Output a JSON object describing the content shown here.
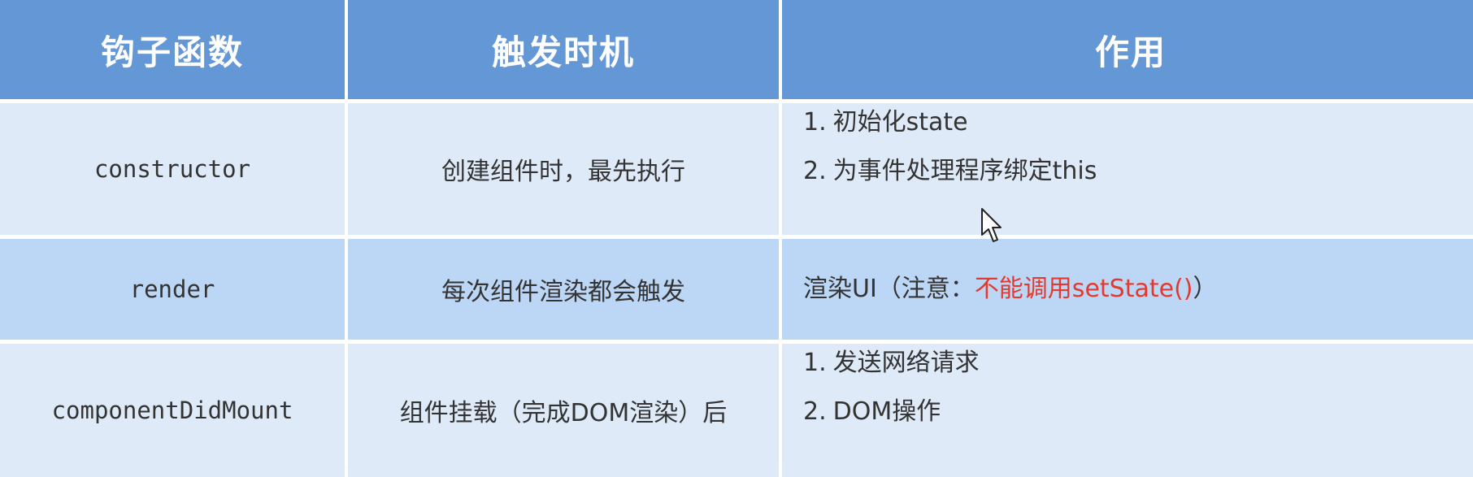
{
  "headers": {
    "hook": "钩子函数",
    "timing": "触发时机",
    "effect": "作用"
  },
  "rows": [
    {
      "hook": "constructor",
      "timing": "创建组件时，最先执行",
      "effects": [
        {
          "num": "1.",
          "text": "初始化state"
        },
        {
          "num": "2.",
          "text": "为事件处理程序绑定this"
        }
      ]
    },
    {
      "hook": "render",
      "timing": "每次组件渲染都会触发",
      "effect_prefix": "渲染UI（注意：",
      "effect_warning": "不能调用setState()",
      "effect_suffix": "）"
    },
    {
      "hook": "componentDidMount",
      "timing": "组件挂载（完成DOM渲染）后",
      "effects": [
        {
          "num": "1.",
          "text": "发送网络请求"
        },
        {
          "num": "2.",
          "text": "DOM操作"
        }
      ]
    }
  ],
  "colors": {
    "header_bg": "#6497d6",
    "row_light": "#dfeaf8",
    "row_dark": "#bcd6f6",
    "warning_text": "#e33a2f"
  },
  "icons": {
    "cursor": "mouse-pointer-icon"
  }
}
